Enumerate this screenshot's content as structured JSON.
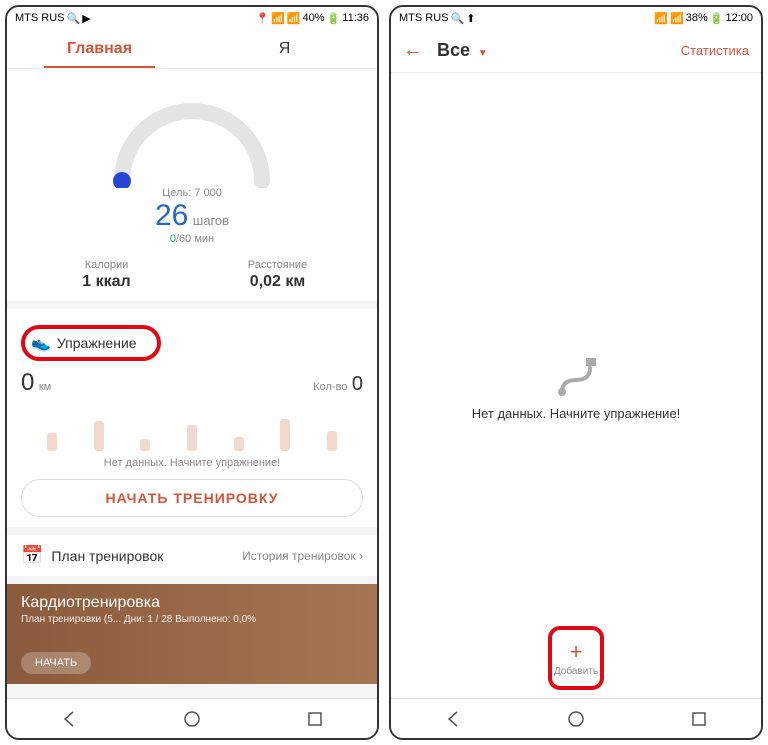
{
  "phone1": {
    "status": {
      "carrier": "MTS RUS",
      "battery": "40%",
      "time": "11:36"
    },
    "tabs": {
      "main": "Главная",
      "me": "Я"
    },
    "gauge": {
      "goal": "Цель: 7 000",
      "steps_value": "26",
      "steps_label": "шагов",
      "mins_cur": "0",
      "mins_total": "/60 мин"
    },
    "calories": {
      "label": "Калории",
      "value": "1 ккал"
    },
    "distance": {
      "label": "Расстояние",
      "value": "0,02 км"
    },
    "exercise": {
      "label": "Упражнение"
    },
    "km": {
      "value": "0",
      "label": "км",
      "count_label": "Кол-во",
      "count_value": "0"
    },
    "no_data": "Нет данных. Начните упражнение!",
    "start_training": "НАЧАТЬ ТРЕНИРОВКУ",
    "plan": {
      "label": "План тренировок",
      "history": "История тренировок  ›"
    },
    "cardio": {
      "title": "Кардиотренировка",
      "sub": "План тренировки (5...    Дни: 1 / 28   Выполнено: 0,0%",
      "start": "НАЧАТЬ"
    }
  },
  "phone2": {
    "status": {
      "carrier": "MTS RUS",
      "battery": "38%",
      "time": "12:00"
    },
    "header": {
      "filter": "Все",
      "stats": "Статистика"
    },
    "empty": "Нет данных. Начните упражнение!",
    "add": {
      "label": "Добавить"
    }
  }
}
